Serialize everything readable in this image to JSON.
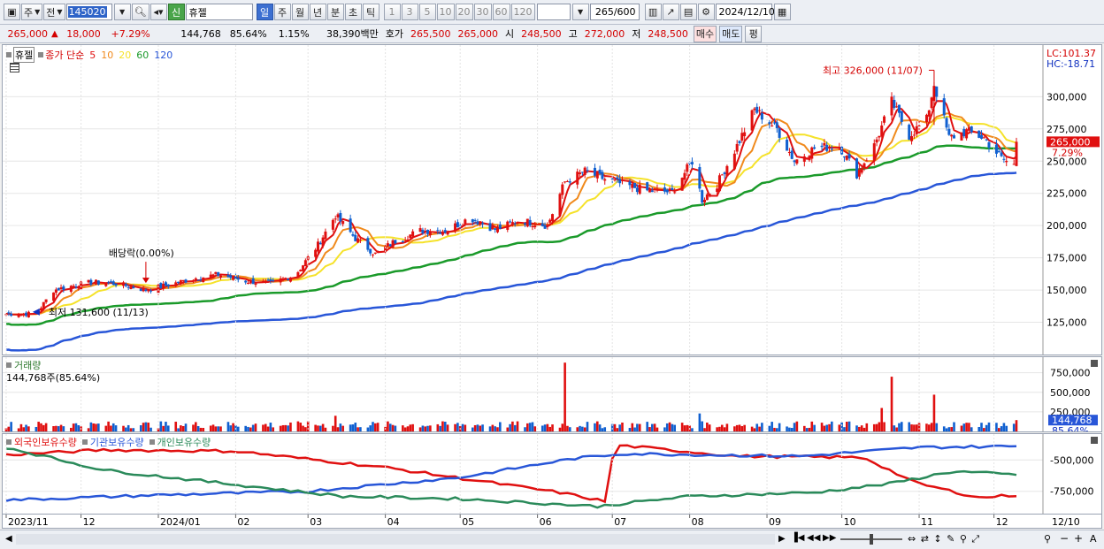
{
  "toolbar": {
    "market": "주",
    "code_type": "전",
    "code": "145020",
    "badge": "신",
    "name": "휴젤",
    "periods": [
      "일",
      "주",
      "월",
      "년",
      "분",
      "초",
      "틱"
    ],
    "intervals": [
      "1",
      "3",
      "5",
      "10",
      "20",
      "30",
      "60",
      "120"
    ],
    "count": "265",
    "count_total": "/600",
    "date": "2024/12/10"
  },
  "quote": {
    "price": "265,000",
    "change": "18,000",
    "change_pct": "+7.29%",
    "volume": "144,768",
    "volume_ratio": "85.64%",
    "turnover": "1.15%",
    "amount": "38,390백만",
    "bid_label": "호가",
    "bid1": "265,500",
    "bid2": "265,000",
    "open_label": "시",
    "open": "248,500",
    "high_label": "고",
    "high": "272,000",
    "low_label": "저",
    "low": "248,500",
    "buy_label": "매수",
    "sell_label": "매도",
    "eval_label": "평"
  },
  "price_panel": {
    "stock_label": "휴젤",
    "legend_title": "종가 단순",
    "ma_legend": [
      "5",
      "10",
      "20",
      "60",
      "120"
    ],
    "lc": "LC:101.37",
    "hc": "HC:-18.71",
    "max_note": "최고 326,000 (11/07)",
    "min_note": "최저 131,600 (11/13)",
    "dividend_note": "배당락(0.00%)",
    "current_price": "265,000",
    "current_pct": "7.29%"
  },
  "volume_panel": {
    "title": "거래량",
    "info": "144,768주(85.64%)",
    "current": "144,768",
    "current_pct": "85.64%"
  },
  "holding_panel": {
    "legend": [
      "외국인보유수량",
      "기관보유수량",
      "개인보유수량"
    ]
  },
  "date_axis": [
    "2023/11",
    "12",
    "2024/01",
    "02",
    "03",
    "04",
    "05",
    "06",
    "07",
    "08",
    "09",
    "10",
    "11",
    "12"
  ],
  "date_axis_last": "12/10",
  "colors": {
    "up": "#e01010",
    "down": "#1060d0",
    "ma5": "#e01010",
    "ma10": "#f08a1c",
    "ma20": "#f5e22a",
    "ma60": "#1a9a2a",
    "ma120": "#2856d8",
    "foreign": "#e01010",
    "institution": "#2856d8",
    "individual": "#2a8a5a"
  },
  "chart_data": [
    {
      "type": "candlestick",
      "title": "휴젤",
      "legend": [
        "종가 단순 5",
        "10",
        "20",
        "60",
        "120"
      ],
      "x_start": "2023-11-01",
      "x_end": "2024-12-10",
      "ylim": [
        100000,
        340000
      ],
      "y_ticks": [
        125000,
        150000,
        175000,
        200000,
        225000,
        250000,
        275000,
        300000
      ],
      "y_tick_labels": [
        "125,000",
        "150,000",
        "175,000",
        "200,000",
        "225,000",
        "250,000",
        "275,000",
        "300,000"
      ],
      "close_path": [
        [
          "2023-11-13",
          131600
        ],
        [
          "2023-11-20",
          150000
        ],
        [
          "2023-11-27",
          153000
        ],
        [
          "2023-12-05",
          156000
        ],
        [
          "2023-12-15",
          155000
        ],
        [
          "2023-12-27",
          150000
        ],
        [
          "2024-01-05",
          154000
        ],
        [
          "2024-01-15",
          159000
        ],
        [
          "2024-01-25",
          162000
        ],
        [
          "2024-02-05",
          157000
        ],
        [
          "2024-02-15",
          155000
        ],
        [
          "2024-02-25",
          162000
        ],
        [
          "2024-03-05",
          185000
        ],
        [
          "2024-03-12",
          208000
        ],
        [
          "2024-03-20",
          190000
        ],
        [
          "2024-03-28",
          178000
        ],
        [
          "2024-04-05",
          188000
        ],
        [
          "2024-04-15",
          196000
        ],
        [
          "2024-04-25",
          196000
        ],
        [
          "2024-05-05",
          206000
        ],
        [
          "2024-05-15",
          197000
        ],
        [
          "2024-05-25",
          204000
        ],
        [
          "2024-06-05",
          200000
        ],
        [
          "2024-06-12",
          234000
        ],
        [
          "2024-06-20",
          242000
        ],
        [
          "2024-06-28",
          236000
        ],
        [
          "2024-07-05",
          232000
        ],
        [
          "2024-07-15",
          227000
        ],
        [
          "2024-07-25",
          226000
        ],
        [
          "2024-08-02",
          250000
        ],
        [
          "2024-08-06",
          220000
        ],
        [
          "2024-08-12",
          232000
        ],
        [
          "2024-08-20",
          262000
        ],
        [
          "2024-08-27",
          290000
        ],
        [
          "2024-09-05",
          275000
        ],
        [
          "2024-09-12",
          250000
        ],
        [
          "2024-09-20",
          260000
        ],
        [
          "2024-09-30",
          262000
        ],
        [
          "2024-10-07",
          240000
        ],
        [
          "2024-10-14",
          262000
        ],
        [
          "2024-10-21",
          296000
        ],
        [
          "2024-10-28",
          270000
        ],
        [
          "2024-11-04",
          282000
        ],
        [
          "2024-11-07",
          310000
        ],
        [
          "2024-11-13",
          268000
        ],
        [
          "2024-11-20",
          273000
        ],
        [
          "2024-11-27",
          268000
        ],
        [
          "2024-12-04",
          252000
        ],
        [
          "2024-12-09",
          247000
        ],
        [
          "2024-12-10",
          265000
        ]
      ],
      "last_close": 265000,
      "last_change": 18000,
      "last_change_pct": 7.29,
      "high": {
        "date": "2024-11-07",
        "value": 326000
      },
      "low": {
        "date": "2023-11-13",
        "value": 131600
      }
    },
    {
      "type": "bar",
      "title": "거래량",
      "ylim": [
        0,
        950000
      ],
      "y_ticks": [
        250000,
        500000,
        750000
      ],
      "y_tick_labels": [
        "250,000",
        "500,000",
        "750,000"
      ],
      "spikes": [
        {
          "date": "2024-06-12",
          "value": 880000
        },
        {
          "date": "2024-10-21",
          "value": 700000
        },
        {
          "date": "2024-11-07",
          "value": 470000
        },
        {
          "date": "2024-10-17",
          "value": 300000
        },
        {
          "date": "2024-08-05",
          "value": 230000
        },
        {
          "date": "2024-03-12",
          "value": 200000
        }
      ],
      "last": {
        "date": "2024-12-10",
        "value": 144768,
        "ratio_pct": 85.64
      }
    },
    {
      "type": "line",
      "title": "보유수량",
      "y_tick_labels": [
        "-500,000",
        "-750,000"
      ],
      "series": [
        {
          "name": "외국인보유수량",
          "points": [
            [
              "2023-11-01",
              -460000
            ],
            [
              "2023-12-10",
              -420000
            ],
            [
              "2024-02-01",
              -430000
            ],
            [
              "2024-04-01",
              -560000
            ],
            [
              "2024-06-10",
              -760000
            ],
            [
              "2024-06-28",
              -830000
            ],
            [
              "2024-07-02",
              -380000
            ],
            [
              "2024-08-20",
              -470000
            ],
            [
              "2024-10-10",
              -480000
            ],
            [
              "2024-10-30",
              -680000
            ],
            [
              "2024-11-25",
              -800000
            ],
            [
              "2024-12-10",
              -780000
            ]
          ]
        },
        {
          "name": "기관보유수량",
          "points": [
            [
              "2023-11-01",
              -820000
            ],
            [
              "2024-01-01",
              -780000
            ],
            [
              "2024-03-01",
              -750000
            ],
            [
              "2024-05-01",
              -640000
            ],
            [
              "2024-06-15",
              -490000
            ],
            [
              "2024-07-05",
              -450000
            ],
            [
              "2024-09-15",
              -470000
            ],
            [
              "2024-11-01",
              -400000
            ],
            [
              "2024-12-10",
              -390000
            ]
          ]
        },
        {
          "name": "개인보유수량",
          "points": [
            [
              "2023-11-01",
              -400000
            ],
            [
              "2023-12-10",
              -580000
            ],
            [
              "2024-01-15",
              -660000
            ],
            [
              "2024-03-15",
              -790000
            ],
            [
              "2024-05-01",
              -810000
            ],
            [
              "2024-06-25",
              -870000
            ],
            [
              "2024-08-01",
              -790000
            ],
            [
              "2024-09-20",
              -760000
            ],
            [
              "2024-10-20",
              -690000
            ],
            [
              "2024-11-15",
              -590000
            ],
            [
              "2024-12-10",
              -620000
            ]
          ]
        }
      ]
    }
  ]
}
